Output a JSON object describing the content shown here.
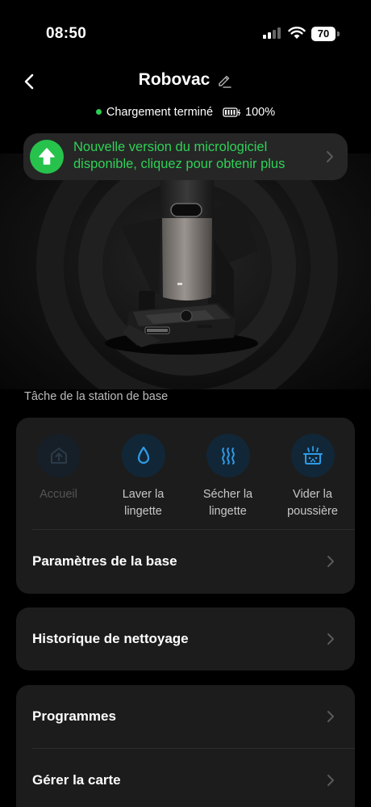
{
  "status_bar": {
    "time": "08:50",
    "battery": "70"
  },
  "header": {
    "title": "Robovac"
  },
  "charging": {
    "status": "Chargement terminé",
    "battery_level": "100%"
  },
  "banner": {
    "line1": "Nouvelle version du micrologiciel",
    "line2": "disponible, cliquez pour obtenir plus"
  },
  "station_tasks": {
    "section_label": "Tâche de la station de base",
    "items": [
      {
        "label": "Accueil",
        "icon": "home-icon",
        "enabled": false
      },
      {
        "label": "Laver la lingette",
        "icon": "water-drop-icon",
        "enabled": true
      },
      {
        "label": "Sécher la lingette",
        "icon": "heat-waves-icon",
        "enabled": true
      },
      {
        "label": "Vider la poussière",
        "icon": "dust-bin-icon",
        "enabled": true
      }
    ]
  },
  "menu": {
    "base_settings": "Paramètres de la base",
    "cleaning_history": "Historique de nettoyage",
    "schedules": "Programmes",
    "manage_map": "Gérer la carte"
  },
  "colors": {
    "accent_green": "#2fd157",
    "task_icon_blue": "#2f9be6",
    "card_bg": "#1c1c1c",
    "background": "#000000"
  }
}
